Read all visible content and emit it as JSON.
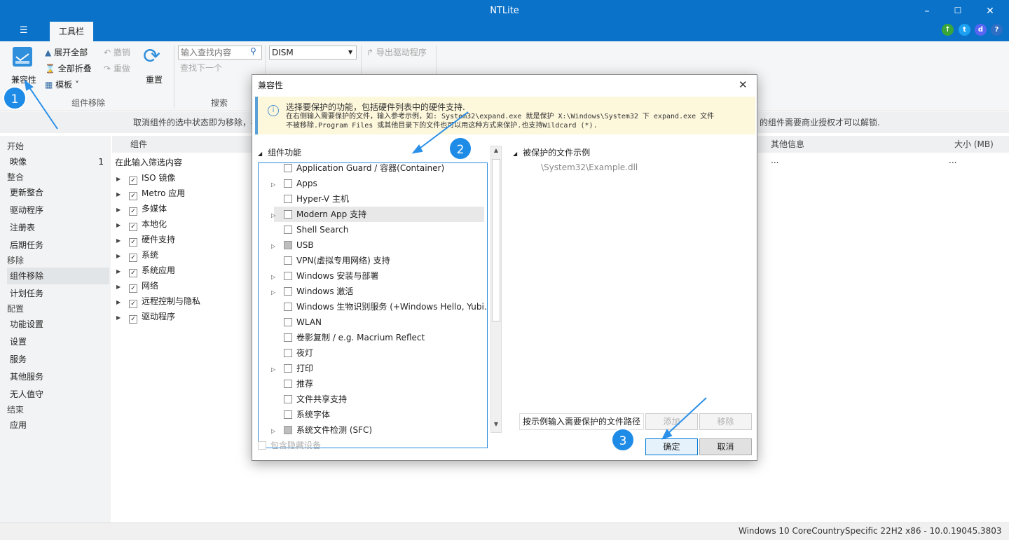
{
  "app": {
    "title": "NTLite",
    "tab": "工具栏"
  },
  "ribbon": {
    "compat_label": "兼容性",
    "expand_all": "展开全部",
    "collapse_all": "全部折叠",
    "template": "模板",
    "undo": "撤销",
    "redo": "重做",
    "reset": "重置",
    "group_component": "组件移除",
    "search_placeholder": "输入查找内容",
    "find_next": "查找下一个",
    "group_search": "搜索",
    "dism_value": "DISM",
    "export_drivers": "导出驱动程序"
  },
  "info_strip": "取消组件的选中状态即为移除，标",
  "info_strip_right": "的组件需要商业授权才可以解锁.",
  "sidebar": {
    "sections": [
      {
        "header": "开始",
        "items": [
          {
            "label": "映像",
            "count": "1"
          }
        ]
      },
      {
        "header": "整合",
        "items": [
          {
            "label": "更新整合"
          },
          {
            "label": "驱动程序"
          },
          {
            "label": "注册表"
          },
          {
            "label": "后期任务"
          }
        ]
      },
      {
        "header": "移除",
        "items": [
          {
            "label": "组件移除",
            "selected": true
          },
          {
            "label": "计划任务"
          }
        ]
      },
      {
        "header": "配置",
        "items": [
          {
            "label": "功能设置"
          },
          {
            "label": "设置"
          },
          {
            "label": "服务"
          },
          {
            "label": "其他服务"
          },
          {
            "label": "无人值守"
          }
        ]
      },
      {
        "header": "结束",
        "items": [
          {
            "label": "应用"
          }
        ]
      }
    ]
  },
  "main": {
    "col_component": "组件",
    "col_other": "其他信息",
    "col_size": "大小 (MB)",
    "filter_hint": "在此输入筛选内容",
    "row_other": "...",
    "row_size": "...",
    "items": [
      "ISO 镜像",
      "Metro 应用",
      "多媒体",
      "本地化",
      "硬件支持",
      "系统",
      "系统应用",
      "网络",
      "远程控制与隐私",
      "驱动程序"
    ]
  },
  "status": "Windows 10 CoreCountrySpecific 22H2 x86 - 10.0.19045.3803",
  "dialog": {
    "title": "兼容性",
    "info_line1": "选择要保护的功能，包括硬件列表中的硬件支持.",
    "info_line2": "在右侧输入需要保护的文件，输入参考示例，如: System32\\expand.exe 就是保护 X:\\Windows\\System32 下 expand.exe 文件",
    "info_line3": "不被移除.Program Files 或其他目录下的文件也可以用这种方式来保护.也支持Wildcard (*).",
    "tree_header": "组件功能",
    "tree_items": [
      {
        "label": "Application Guard / 容器(Container)",
        "expand": false,
        "state": "off"
      },
      {
        "label": "Apps",
        "expand": true,
        "state": "off"
      },
      {
        "label": "Hyper-V 主机",
        "expand": false,
        "state": "off"
      },
      {
        "label": "Modern App 支持",
        "expand": true,
        "state": "off",
        "highlight": true
      },
      {
        "label": "Shell Search",
        "expand": false,
        "state": "off"
      },
      {
        "label": "USB",
        "expand": true,
        "state": "partial"
      },
      {
        "label": "VPN(虚拟专用网络) 支持",
        "expand": false,
        "state": "off"
      },
      {
        "label": "Windows 安装与部署",
        "expand": true,
        "state": "off"
      },
      {
        "label": "Windows 激活",
        "expand": true,
        "state": "off"
      },
      {
        "label": "Windows 生物识别服务 (+Windows Hello, Yubi...",
        "expand": false,
        "state": "off"
      },
      {
        "label": "WLAN",
        "expand": false,
        "state": "off"
      },
      {
        "label": "卷影复制 / e.g. Macrium Reflect",
        "expand": false,
        "state": "off"
      },
      {
        "label": "夜灯",
        "expand": false,
        "state": "off"
      },
      {
        "label": "打印",
        "expand": true,
        "state": "off"
      },
      {
        "label": "推荐",
        "expand": false,
        "state": "off"
      },
      {
        "label": "文件共享支持",
        "expand": false,
        "state": "off"
      },
      {
        "label": "系统字体",
        "expand": false,
        "state": "off"
      },
      {
        "label": "系统文件检测 (SFC)",
        "expand": true,
        "state": "partial"
      }
    ],
    "include_hidden": "包含隐藏设备",
    "right_header": "被保护的文件示例",
    "right_example": "\\System32\\Example.dll",
    "path_label": "按示例输入需要保护的文件路径",
    "add": "添加",
    "remove": "移除",
    "ok": "确定",
    "cancel": "取消"
  },
  "badges": [
    "1",
    "2",
    "3"
  ],
  "colors": {
    "accent": "#0a72c9",
    "badge": "#1e8be6",
    "selection": "#2a8be0"
  }
}
